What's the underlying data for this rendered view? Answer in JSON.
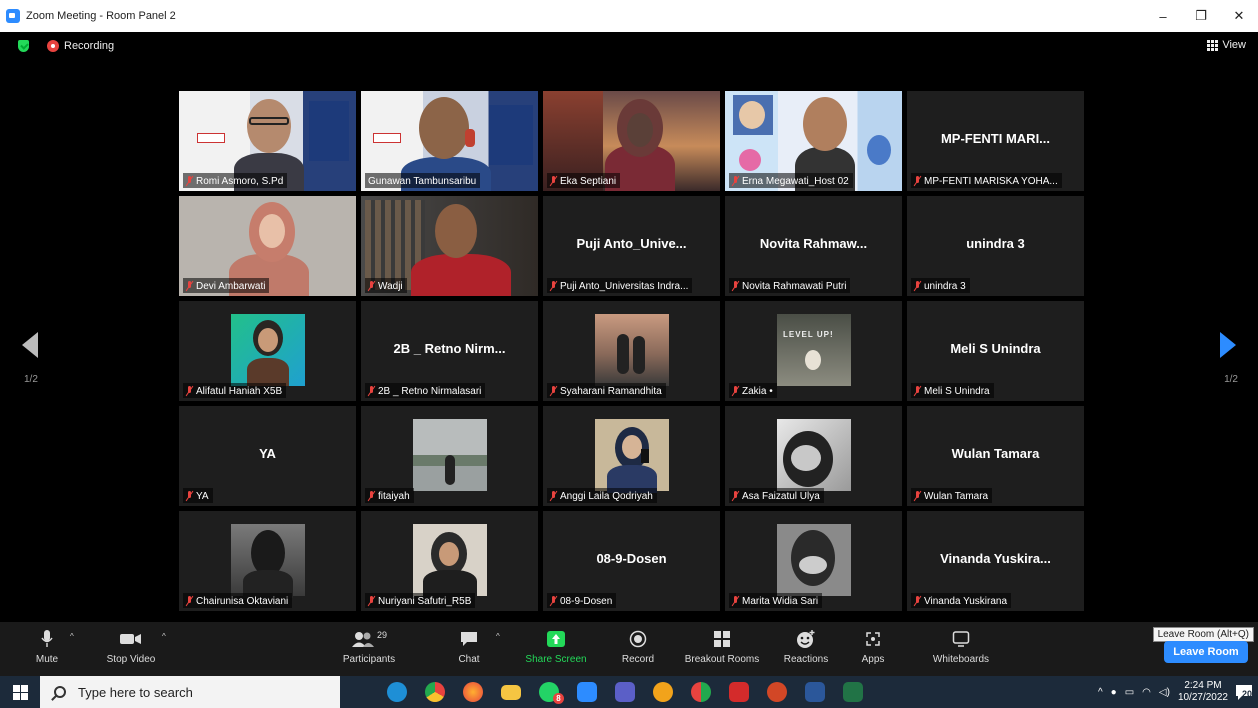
{
  "window": {
    "title": "Zoom Meeting - Room Panel 2",
    "controls": [
      "–",
      "❐",
      "✕"
    ]
  },
  "meeting": {
    "recording_label": "Recording",
    "view_label": "View",
    "page_left": "1/2",
    "page_right": "1/2"
  },
  "tiles": [
    {
      "name": "Romi Asmoro, S.Pd",
      "big": ""
    },
    {
      "name": "Gunawan Tambunsaribu",
      "big": ""
    },
    {
      "name": "Eka Septiani",
      "big": ""
    },
    {
      "name": "Erna Megawati_Host 02",
      "big": ""
    },
    {
      "name": "MP-FENTI MARISKA YOHA...",
      "big": "MP-FENTI  MARI..."
    },
    {
      "name": "Devi Ambarwati",
      "big": ""
    },
    {
      "name": "Wadji",
      "big": ""
    },
    {
      "name": "Puji Anto_Universitas Indra...",
      "big": "Puji  Anto_Unive..."
    },
    {
      "name": "Novita Rahmawati Putri",
      "big": "Novita  Rahmaw..."
    },
    {
      "name": "unindra 3",
      "big": "unindra 3"
    },
    {
      "name": "Alifatul Haniah X5B",
      "big": ""
    },
    {
      "name": "2B _ Retno Nirmalasari",
      "big": "2B _ Retno  Nirm..."
    },
    {
      "name": "Syaharani Ramandhita",
      "big": ""
    },
    {
      "name": "Zakia •",
      "big": ""
    },
    {
      "name": "Meli S Unindra",
      "big": "Meli S Unindra"
    },
    {
      "name": "YA",
      "big": "YA"
    },
    {
      "name": "fitaiyah",
      "big": ""
    },
    {
      "name": "Anggi Laila Qodriyah",
      "big": ""
    },
    {
      "name": "Asa Faizatul Ulya",
      "big": ""
    },
    {
      "name": "Wulan Tamara",
      "big": "Wulan Tamara"
    },
    {
      "name": "Chairunisa Oktaviani",
      "big": ""
    },
    {
      "name": "Nuriyani Safutri_R5B",
      "big": ""
    },
    {
      "name": "08-9-Dosen",
      "big": "08-9-Dosen"
    },
    {
      "name": "Marita Widia Sari",
      "big": ""
    },
    {
      "name": "Vinanda Yuskirana",
      "big": "Vinanda  Yuskira..."
    }
  ],
  "toolbar": {
    "mute": "Mute",
    "stop_video": "Stop Video",
    "participants": "Participants",
    "participants_count": "29",
    "chat": "Chat",
    "share_screen": "Share Screen",
    "record": "Record",
    "breakout_rooms": "Breakout Rooms",
    "reactions": "Reactions",
    "apps": "Apps",
    "whiteboards": "Whiteboards",
    "leave_room": "Leave Room",
    "leave_tooltip": "Leave Room (Alt+Q)"
  },
  "taskbar": {
    "search_placeholder": "Type here to search",
    "time": "2:24 PM",
    "date": "10/27/2022",
    "notifications": "20",
    "whatsapp_badge": "8"
  },
  "colors": {
    "accent": "#2d8cff",
    "active_speaker": "#c5e83b",
    "muted": "#e8433f",
    "share_green": "#23d959"
  }
}
